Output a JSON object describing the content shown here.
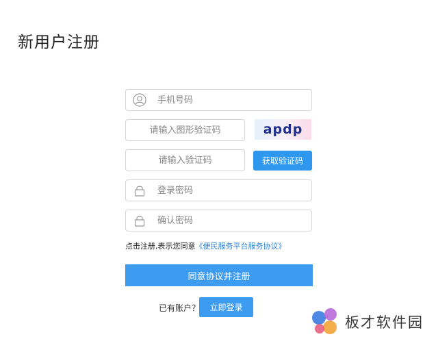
{
  "page": {
    "title": "新用户注册"
  },
  "form": {
    "phone": {
      "placeholder": "手机号码",
      "value": "",
      "icon": "user-icon"
    },
    "image_captcha": {
      "placeholder": "请输入图形验证码",
      "value": "",
      "captcha_text": "apdp"
    },
    "sms_code": {
      "placeholder": "请输入验证码",
      "value": "",
      "button_label": "获取验证码"
    },
    "password": {
      "placeholder": "登录密码",
      "value": "",
      "icon": "lock-icon"
    },
    "confirm_password": {
      "placeholder": "确认密码",
      "value": "",
      "icon": "lock-icon"
    },
    "agreement": {
      "prefix": "点击注册,表示您同意",
      "link_text": "《便民服务平台服务协议》"
    },
    "submit_label": "同意协议并注册",
    "login_prompt": "已有账户？",
    "login_label": "立即登录"
  },
  "watermark": {
    "text": "板才软件园"
  },
  "colors": {
    "primary": "#3d9cf0",
    "link": "#2e7fd6",
    "border": "#d6d6d6",
    "placeholder": "#888888"
  }
}
